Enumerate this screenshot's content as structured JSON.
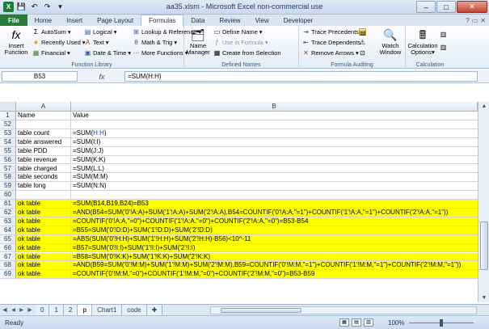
{
  "window": {
    "title": "aa35.xlsm - Microsoft Excel non-commercial use",
    "minimize": "–",
    "maximize": "□",
    "close": "✕"
  },
  "tabs": [
    "File",
    "Home",
    "Insert",
    "Page Layout",
    "Formulas",
    "Data",
    "Review",
    "View",
    "Developer"
  ],
  "ribbon": {
    "insert_function": [
      "Insert",
      "Function"
    ],
    "autosum": "AutoSum",
    "recently_used": "Recently Used",
    "financial": "Financial",
    "logical": "Logical",
    "text": "Text",
    "date_time": "Date & Time",
    "lookup": "Lookup & Reference",
    "math": "Math & Trig",
    "more": "More Functions",
    "function_library": "Function Library",
    "name_manager": [
      "Name",
      "Manager"
    ],
    "define_name": "Define Name",
    "use_in_formula": "Use in Formula",
    "create_from_selection": "Create from Selection",
    "defined_names": "Defined Names",
    "trace_precedents": "Trace Precedents",
    "trace_dependents": "Trace Dependents",
    "remove_arrows": "Remove Arrows",
    "watch_window": [
      "Watch",
      "Window"
    ],
    "formula_auditing": "Formula Auditing",
    "calc_options": [
      "Calculation",
      "Options"
    ],
    "calculation": "Calculation"
  },
  "formula_bar": {
    "name_box": "B53",
    "fx": "fx",
    "formula": "=SUM(H:H)"
  },
  "grid": {
    "col_headers": [
      "A",
      "B"
    ],
    "header_row": {
      "num": "1",
      "a": "Name",
      "b": "Value"
    },
    "rows": [
      {
        "num": "52",
        "a": "",
        "b": "",
        "hl": false
      },
      {
        "num": "53",
        "a": "table count",
        "b": "=SUM(H:H)",
        "hl": false,
        "blue": true
      },
      {
        "num": "54",
        "a": "table answered",
        "b": "=SUM(I:I)",
        "hl": false
      },
      {
        "num": "55",
        "a": "table PDD",
        "b": "=SUM(J:J)",
        "hl": false
      },
      {
        "num": "56",
        "a": "table revenue",
        "b": "=SUM(K:K)",
        "hl": false
      },
      {
        "num": "57",
        "a": "table charged",
        "b": "=SUM(L:L)",
        "hl": false
      },
      {
        "num": "58",
        "a": "table seconds",
        "b": "=SUM(M:M)",
        "hl": false
      },
      {
        "num": "59",
        "a": "table long",
        "b": "=SUM(N:N)",
        "hl": false
      },
      {
        "num": "60",
        "a": "",
        "b": "",
        "hl": false
      },
      {
        "num": "61",
        "a": "ok table",
        "b": "=SUM(B14,B19,B24)=B53",
        "hl": true
      },
      {
        "num": "62",
        "a": "ok table",
        "b": "=AND(B54=SUM('0'!A:A)+SUM('1'!A:A)+SUM('2'!A:A),B54=COUNTIF('0'!A:A,\"=1\")+COUNTIF('1'!A:A,\"=1\")+COUNTIF('2'!A:A,\"=1\"))",
        "hl": true
      },
      {
        "num": "63",
        "a": "ok table",
        "b": "=COUNTIF('0'!A:A,\"=0\")+COUNTIF('1'!A:A,\"=0\")+COUNTIF('2'!A:A,\"=0\")=B53-B54",
        "hl": true
      },
      {
        "num": "64",
        "a": "ok table",
        "b": "=B55=SUM('0'!D:D)+SUM('1'!D:D)+SUM('2'!D:D)",
        "hl": true
      },
      {
        "num": "65",
        "a": "ok table",
        "b": "=ABS(SUM('0'!H:H)+SUM('1'!H:H)+SUM('2'!H:H)-B56)<10^-11",
        "hl": true
      },
      {
        "num": "66",
        "a": "ok table",
        "b": "=B57=SUM('0'!I:I)+SUM('1'!I:I)+SUM('2'!I:I)",
        "hl": true
      },
      {
        "num": "67",
        "a": "ok table",
        "b": "=B58=SUM('0'!K:K)+SUM('1'!K:K)+SUM('2'!K:K)",
        "hl": true
      },
      {
        "num": "68",
        "a": "ok table",
        "b": "=AND(B59=SUM('0'!M:M)+SUM('1'!M:M)+SUM('2'!M:M),B59=COUNTIF('0'!M:M,\"=1\")+COUNTIF('1'!M:M,\"=1\")+COUNTIF('2'!M:M,\"=1\"))",
        "hl": true
      },
      {
        "num": "69",
        "a": "ok table",
        "b": "=COUNTIF('0'!M:M,\"=0\")+COUNTIF('1'!M:M,\"=0\")+COUNTIF('2'!M:M,\"=0\")=B53-B59",
        "hl": true
      }
    ]
  },
  "sheet_tabs": [
    "0",
    "1",
    "2",
    "p",
    "Chart1",
    "code"
  ],
  "active_sheet": "p",
  "status": {
    "ready": "Ready",
    "zoom": "100%"
  },
  "icons": {
    "fx": "fx-icon",
    "sum": "autosum-icon",
    "star": "recently-used-icon"
  }
}
